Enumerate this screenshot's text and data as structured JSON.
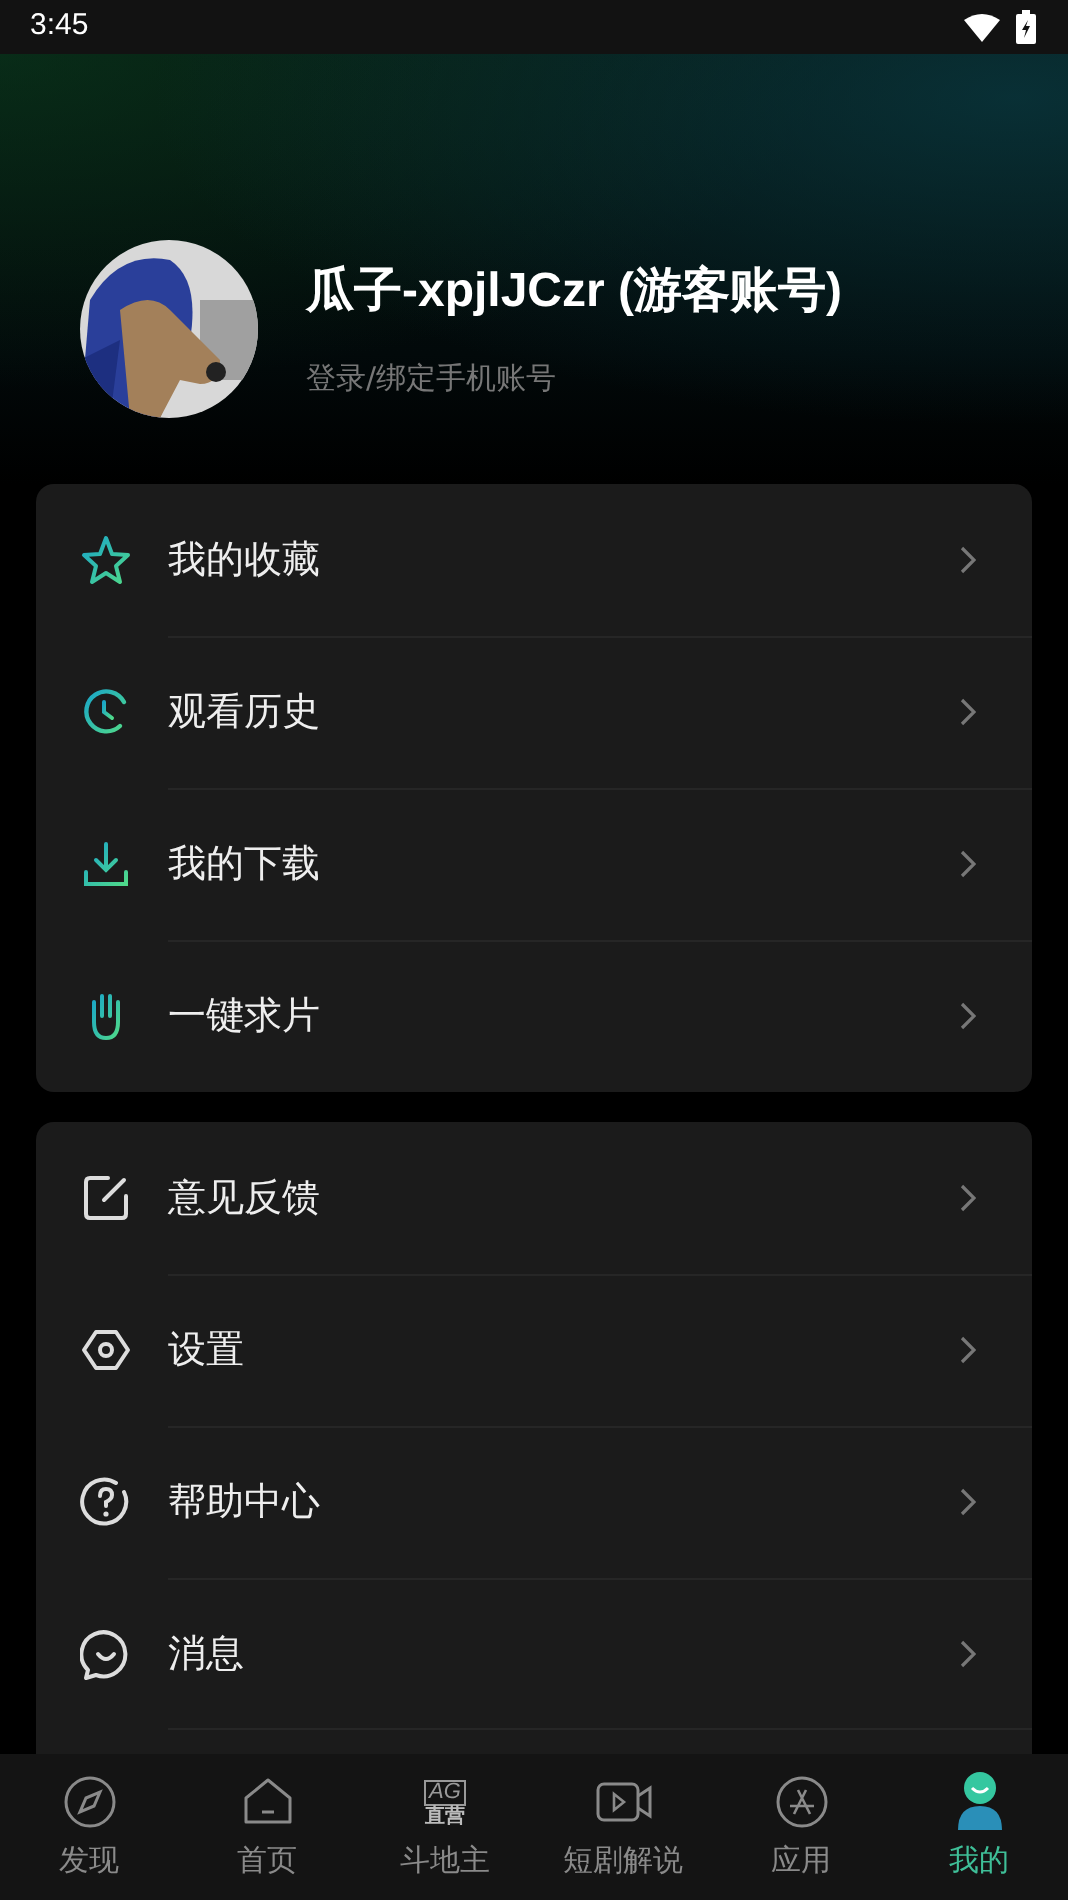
{
  "status_bar": {
    "time": "3:45"
  },
  "profile": {
    "name": "瓜子-xpjlJCzr (游客账号)",
    "subtitle": "登录/绑定手机账号"
  },
  "sections": [
    {
      "items": [
        {
          "label": "我的收藏"
        },
        {
          "label": "观看历史"
        },
        {
          "label": "我的下载"
        },
        {
          "label": "一键求片"
        }
      ]
    },
    {
      "items": [
        {
          "label": "意见反馈"
        },
        {
          "label": "设置"
        },
        {
          "label": "帮助中心"
        },
        {
          "label": "消息"
        }
      ]
    }
  ],
  "bottom_nav": [
    {
      "label": "发现",
      "selected": false
    },
    {
      "label": "首页",
      "selected": false
    },
    {
      "label": "斗地主",
      "selected": false,
      "icon_text": "AG",
      "icon_caption": "直营"
    },
    {
      "label": "短剧解说",
      "selected": false
    },
    {
      "label": "应用",
      "selected": false
    },
    {
      "label": "我的",
      "selected": true
    }
  ]
}
